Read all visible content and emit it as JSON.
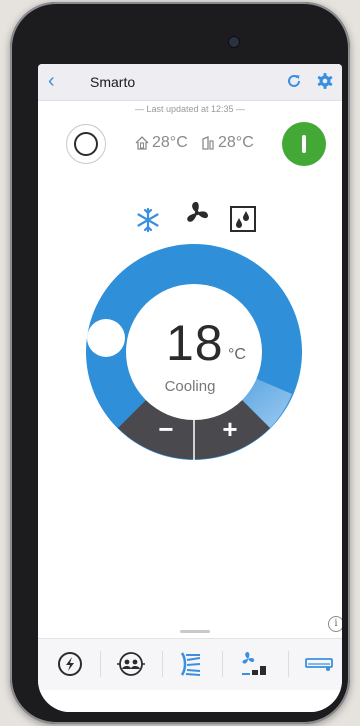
{
  "app": {
    "title": "Smarto",
    "last_updated": "— Last updated at 12:35 —"
  },
  "status": {
    "indoor_temp": "28°C",
    "outdoor_temp": "28°C",
    "power_on": true
  },
  "modes": {
    "items": [
      "cool",
      "fan",
      "dry"
    ],
    "selected": "cool"
  },
  "thermostat": {
    "setpoint": "18",
    "unit": "°C",
    "mode_label": "Cooling",
    "minus_label": "−",
    "plus_label": "+"
  },
  "info_label": "i",
  "tabs": [
    "power-schedule",
    "occupancy-sensor",
    "swing-vane",
    "fan-speed",
    "unit-settings"
  ],
  "colors": {
    "accent": "#3a8fe0",
    "dial_blue": "#2f8fd9",
    "dial_dark": "#4a4a4e",
    "power_green": "#44a837",
    "text_dark": "#2b2b2b"
  }
}
